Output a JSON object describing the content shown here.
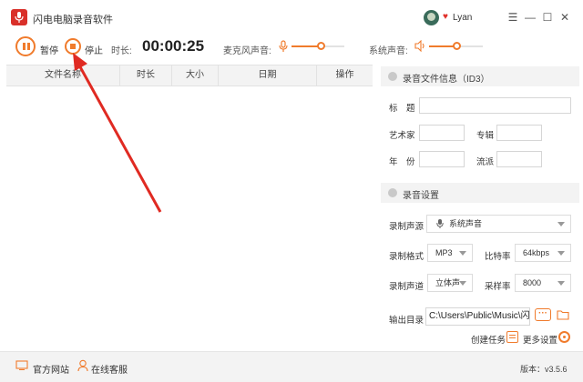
{
  "app": {
    "title": "闪电电脑录音软件"
  },
  "user": {
    "name": "Lyan"
  },
  "window_controls": {
    "menu": "☰",
    "minimize": "—",
    "maximize": "☐",
    "close": "✕"
  },
  "toolbar": {
    "pause_label": "暂停",
    "stop_label": "停止",
    "duration_label": "时长:",
    "duration_value": "00:00:25",
    "mic_label": "麦克风声音:",
    "mic_level": 0.55,
    "system_label": "系统声音:",
    "system_level": 0.5
  },
  "file_table": {
    "columns": [
      "文件名称",
      "时长",
      "大小",
      "日期",
      "操作"
    ],
    "rows": []
  },
  "id3": {
    "header": "录音文件信息（ID3）",
    "title_label": "标　题",
    "artist_label": "艺术家",
    "album_label": "专辑",
    "year_label": "年　份",
    "genre_label": "流派"
  },
  "settings": {
    "header": "录音设置",
    "source_label": "录制声源",
    "source_value": "系统声音",
    "format_label": "录制格式",
    "format_value": "MP3",
    "bitrate_label": "比特率",
    "bitrate_value": "64kbps",
    "channel_label": "录制声道",
    "channel_value": "立体声",
    "samplerate_label": "采样率",
    "samplerate_value": "8000",
    "output_label": "输出目录",
    "output_value": "C:\\Users\\Public\\Music\\闪电",
    "create_task_label": "创建任务",
    "more_settings_label": "更多设置"
  },
  "footer": {
    "website_label": "官方网站",
    "support_label": "在线客服",
    "version": "版本：v3.5.6"
  },
  "colors": {
    "accent": "#f07b2c",
    "brand_red": "#d9302a",
    "annotation_arrow": "#e02a22"
  }
}
